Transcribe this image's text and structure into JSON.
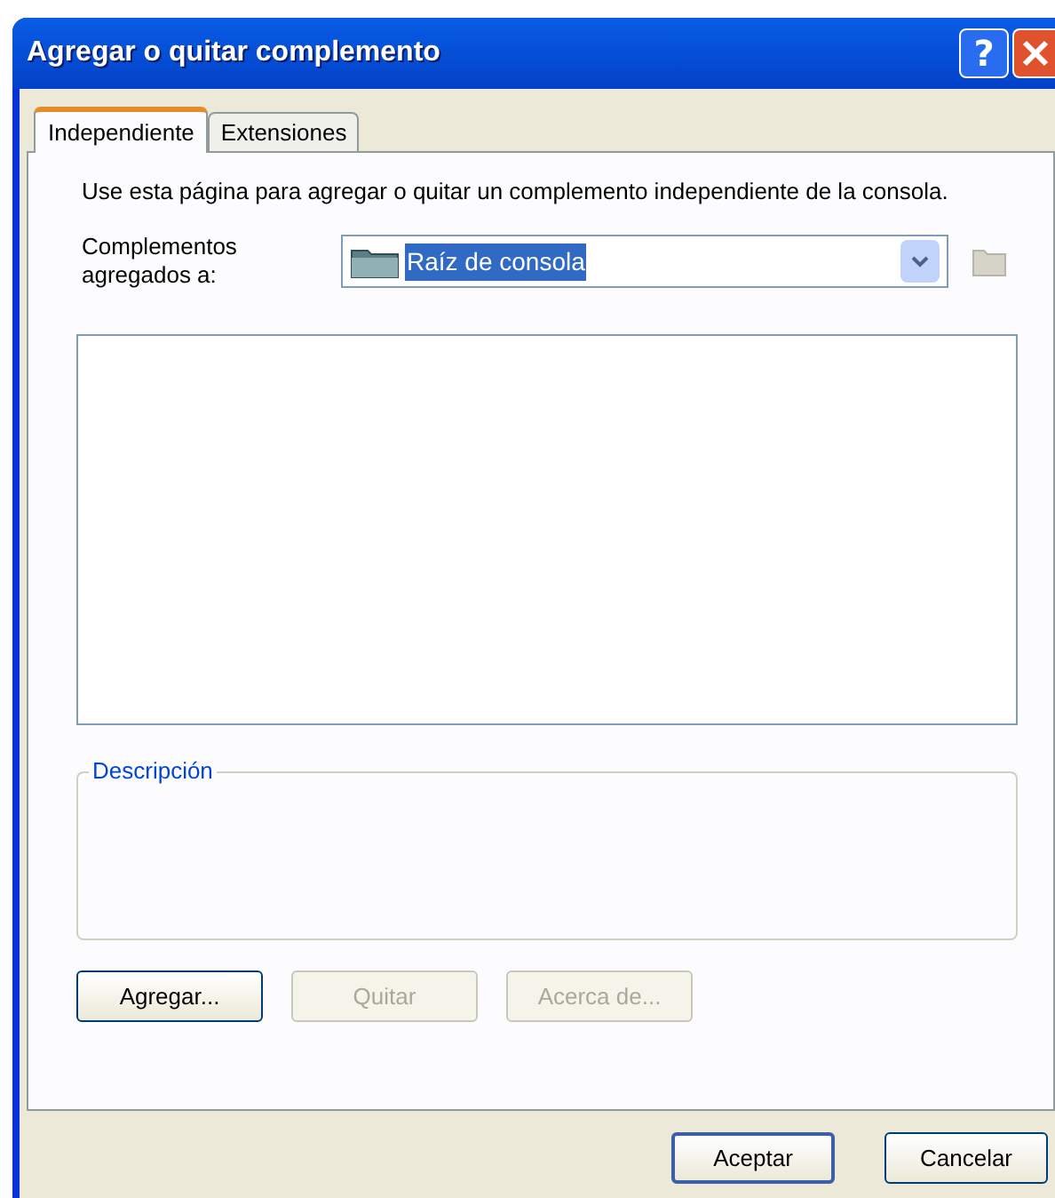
{
  "window": {
    "title": "Agregar o quitar complemento"
  },
  "title_buttons": [
    {
      "kind": "help",
      "label": "?"
    },
    {
      "kind": "close"
    }
  ],
  "tabs": [
    {
      "label": "Independiente",
      "selected": true
    },
    {
      "label": "Extensiones",
      "selected": false
    }
  ],
  "intro": "Use esta página para agregar o quitar un complemento independiente de la consola.",
  "added_to": {
    "label": "Complementos agregados a:",
    "value": "Raíz de consola",
    "value_selected": true
  },
  "description": {
    "legend": "Descripción"
  },
  "panel_buttons": [
    {
      "label": "Agregar...",
      "disabled": false
    },
    {
      "label": "Quitar",
      "disabled": true
    },
    {
      "label": "Acerca de...",
      "disabled": true
    }
  ],
  "dialog_buttons": [
    {
      "label": "Aceptar",
      "default": true
    },
    {
      "label": "Cancelar",
      "default": false
    }
  ]
}
